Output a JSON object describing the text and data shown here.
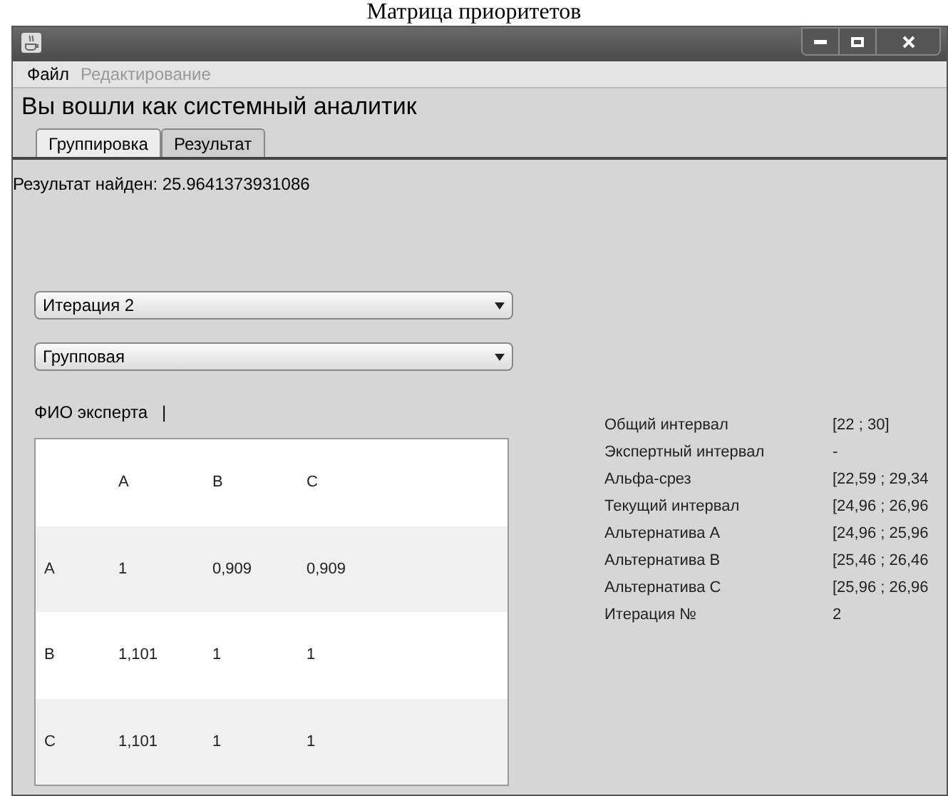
{
  "caption": "Матрица приоритетов",
  "menu": [
    {
      "label": "Файл",
      "disabled": false
    },
    {
      "label": "Редактирование",
      "disabled": true
    }
  ],
  "heading": "Вы вошли как системный аналитик",
  "tabs": [
    {
      "label": "Группировка",
      "selected": false
    },
    {
      "label": "Результат",
      "selected": true
    }
  ],
  "result": "Результат найден: 25.9641373931086",
  "dropdowns": [
    {
      "value": "Итерация 2"
    },
    {
      "value": "Групповая"
    }
  ],
  "expert_label": "ФИО эксперта",
  "expert_value": "|",
  "matrix": {
    "columns": [
      "A",
      "B",
      "C"
    ],
    "rows": [
      {
        "label": "A",
        "cells": [
          "1",
          "0,909",
          "0,909"
        ]
      },
      {
        "label": "B",
        "cells": [
          "1,101",
          "1",
          "1"
        ]
      },
      {
        "label": "C",
        "cells": [
          "1,101",
          "1",
          "1"
        ]
      }
    ]
  },
  "info": [
    {
      "label": "Общий интервал",
      "value": "[22 ; 30]"
    },
    {
      "label": "Экспертный интервал",
      "value": "-"
    },
    {
      "label": "Альфа-срез",
      "value": "[22,59 ; 29,34"
    },
    {
      "label": "Текущий интервал",
      "value": "[24,96 ; 26,96"
    },
    {
      "label": "Альтернатива A",
      "value": "[24,96 ; 25,96"
    },
    {
      "label": "Альтернатива B",
      "value": "[25,46 ; 26,46"
    },
    {
      "label": "Альтернатива C",
      "value": "[25,96 ; 26,96"
    },
    {
      "label": "Итерация №",
      "value": "2"
    }
  ]
}
